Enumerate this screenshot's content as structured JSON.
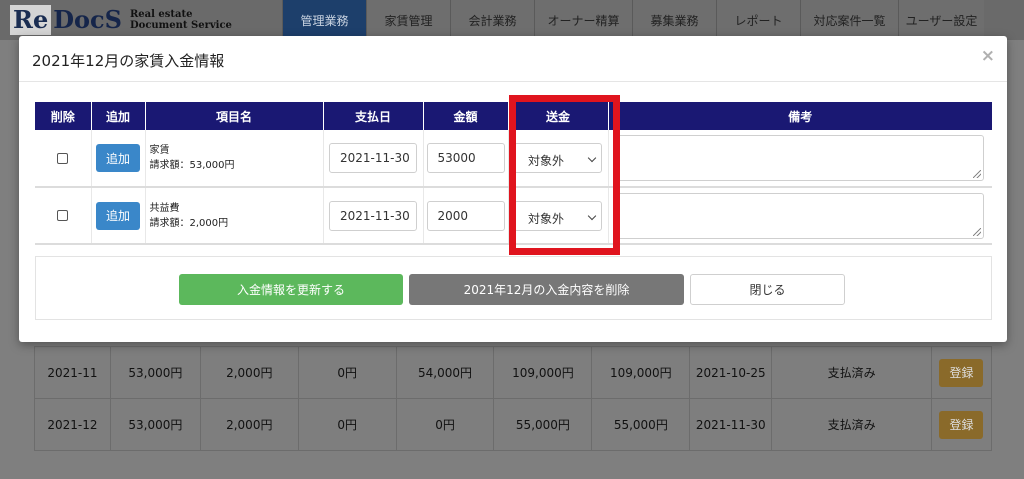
{
  "header": {
    "logo_re": "Re",
    "logo_docs": "DocS",
    "logo_tagline_1": "Real estate",
    "logo_tagline_2": "Document Service",
    "nav": [
      {
        "label": "管理業務",
        "active": true
      },
      {
        "label": "家賃管理",
        "active": false
      },
      {
        "label": "会計業務",
        "active": false
      },
      {
        "label": "オーナー精算",
        "active": false
      },
      {
        "label": "募集業務",
        "active": false
      },
      {
        "label": "レポート",
        "active": false
      },
      {
        "label": "対応案件一覧",
        "active": false
      },
      {
        "label": "ユーザー設定",
        "active": false
      }
    ]
  },
  "background_table": {
    "rows": [
      {
        "month": "2021-11",
        "rent": "53,000円",
        "common": "2,000円",
        "c3": "0円",
        "c4": "54,000円",
        "c5": "109,000円",
        "c6": "109,000円",
        "date": "2021-10-25",
        "status": "支払済み",
        "button": "登録"
      },
      {
        "month": "2021-12",
        "rent": "53,000円",
        "common": "2,000円",
        "c3": "0円",
        "c4": "0円",
        "c5": "55,000円",
        "c6": "55,000円",
        "date": "2021-11-30",
        "status": "支払済み",
        "button": "登録"
      }
    ]
  },
  "modal": {
    "title": "2021年12月の家賃入金情報",
    "close_label": "×",
    "columns": {
      "delete": "削除",
      "add": "追加",
      "item_name": "項目名",
      "pay_date": "支払日",
      "amount": "金額",
      "transfer": "送金",
      "remarks": "備考"
    },
    "rows": [
      {
        "add_label": "追加",
        "item": "家賃",
        "billed": "請求額：53,000円",
        "pay_date": "2021-11-30",
        "amount": "53000",
        "transfer": "対象外",
        "remarks": ""
      },
      {
        "add_label": "追加",
        "item": "共益費",
        "billed": "請求額：2,000円",
        "pay_date": "2021-11-30",
        "amount": "2000",
        "transfer": "対象外",
        "remarks": ""
      }
    ],
    "buttons": {
      "update": "入金情報を更新する",
      "delete": "2021年12月の入金内容を削除",
      "close": "閉じる"
    }
  },
  "colors": {
    "nav_active": "#1d3f6b",
    "table_header": "#1a1873",
    "add_button": "#3a87c9",
    "update_button": "#5cb85c",
    "delete_button": "#777777",
    "highlight": "#e0141e"
  }
}
